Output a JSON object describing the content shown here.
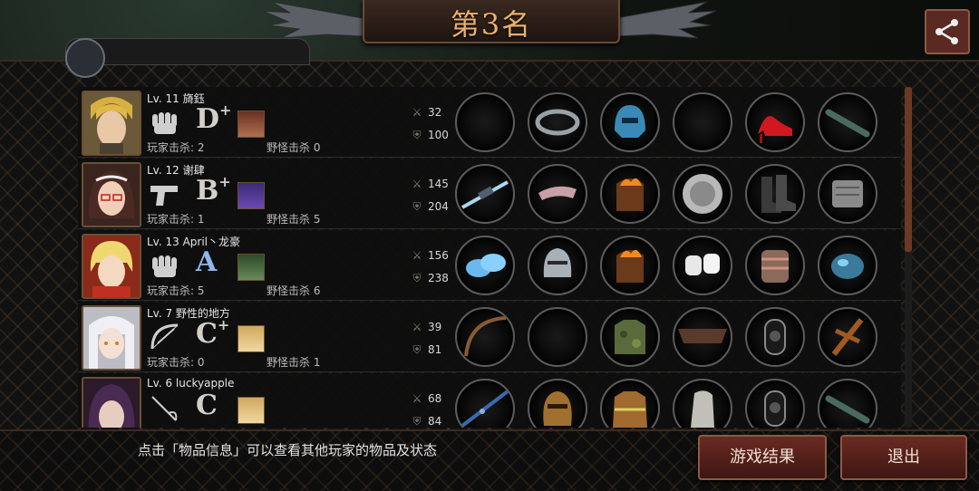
{
  "header": {
    "title": "第3名",
    "previous_tab_text": ""
  },
  "players": [
    {
      "level_name": "Lv. 11 旖鈺",
      "weapon_icon": "fist-icon",
      "grade": "D",
      "grade_plus": "+",
      "kills_label": "玩家击杀: 2",
      "monsters_label": "野怪击杀 0",
      "attack": "32",
      "defense": "100",
      "items": [
        "empty-slot",
        "black-headband-icon",
        "blue-helmet-icon",
        "empty-slot",
        "red-high-heel-icon",
        "dark-stick-icon"
      ]
    },
    {
      "level_name": "Lv. 12 谢肆",
      "weapon_icon": "pistol-icon",
      "grade": "B",
      "grade_plus": "+",
      "kills_label": "玩家击杀: 1",
      "monsters_label": "野怪击杀 5",
      "attack": "145",
      "defense": "204",
      "items": [
        "laser-rifle-icon",
        "pink-mask-icon",
        "flaming-armor-icon",
        "metal-disc-icon",
        "floral-boots-icon",
        "gray-armguard-icon"
      ]
    },
    {
      "level_name": "Lv. 13 April丶龙豪",
      "weapon_icon": "fist-icon",
      "grade": "A",
      "grade_plus": "",
      "kills_label": "玩家击杀: 5",
      "monsters_label": "野怪击杀 6",
      "attack": "156",
      "defense": "238",
      "items": [
        "ice-gauntlets-icon",
        "knight-helmet-icon",
        "flaming-armor-icon",
        "white-bandage-icon",
        "wrapped-bracer-icon",
        "blue-orb-icon"
      ]
    },
    {
      "level_name": "Lv. 7  野性的地方",
      "weapon_icon": "bow-icon",
      "grade": "C",
      "grade_plus": "+",
      "kills_label": "玩家击杀: 0",
      "monsters_label": "野怪击杀 1",
      "attack": "39",
      "defense": "81",
      "items": [
        "wooden-bow-icon",
        "empty-slot",
        "camo-vest-icon",
        "leather-wrap-icon",
        "black-kneepad-icon",
        "wooden-cross-icon"
      ]
    },
    {
      "level_name": "Lv. 6  luckyapple",
      "weapon_icon": "rapier-icon",
      "grade": "C",
      "grade_plus": "",
      "kills_label": "",
      "monsters_label": "",
      "attack": "68",
      "defense": "84",
      "items": [
        "blue-spear-icon",
        "bronze-helmet-icon",
        "firefighter-coat-icon",
        "silver-glove-icon",
        "black-kneepad-icon",
        "dark-stick-icon"
      ]
    }
  ],
  "footer": {
    "hint": "点击「物品信息」可以查看其他玩家的物品及状态",
    "result_button": "游戏结果",
    "exit_button": "退出"
  },
  "colors": {
    "accent": "#e8b070",
    "button": "#6a2a22"
  }
}
